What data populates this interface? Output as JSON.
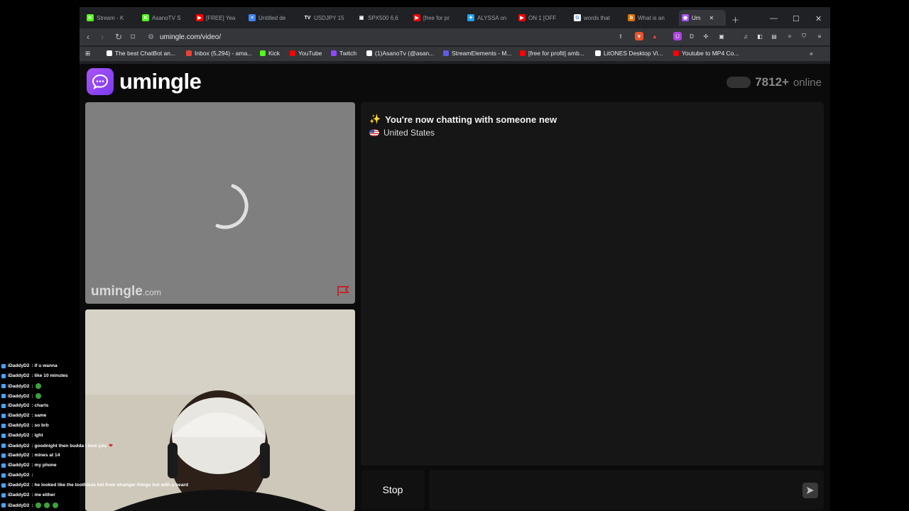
{
  "browser": {
    "tabs": [
      {
        "title": "Stream - K",
        "color": "#53fc18",
        "glyph": "K"
      },
      {
        "title": "AsanoTV S",
        "color": "#53fc18",
        "glyph": "K"
      },
      {
        "title": "[FREE] Yea",
        "color": "#ff0000",
        "glyph": "▶"
      },
      {
        "title": "Untitled de",
        "color": "#4285f4",
        "glyph": "≡"
      },
      {
        "title": "USDJPY 15",
        "color": "#202124",
        "glyph": "TV"
      },
      {
        "title": "SPX500 6,6",
        "color": "#202124",
        "glyph": "▣"
      },
      {
        "title": "[free for pr",
        "color": "#ff0000",
        "glyph": "▶"
      },
      {
        "title": "ALYSSA on",
        "color": "#1da1f2",
        "glyph": "✈"
      },
      {
        "title": "ON 1 [OFF",
        "color": "#ff0000",
        "glyph": "▶"
      },
      {
        "title": "words that",
        "color": "#ffffff",
        "glyph": "G"
      },
      {
        "title": "What is an",
        "color": "#d97706",
        "glyph": "b"
      },
      {
        "title": "Um",
        "color": "#a855f7",
        "glyph": "◉"
      }
    ],
    "url": "umingle.com/video/",
    "bookmarks": [
      {
        "label": "The best ChatBot an...",
        "color": "#ffffff"
      },
      {
        "label": "Inbox (5,294) - ama...",
        "color": "#ea4335"
      },
      {
        "label": "Kick",
        "color": "#53fc18"
      },
      {
        "label": "YouTube",
        "color": "#ff0000"
      },
      {
        "label": "Twitch",
        "color": "#9146ff"
      },
      {
        "label": "(1)AsanoTv (@asan...",
        "color": "#ffffff"
      },
      {
        "label": "StreamElements - M...",
        "color": "#5e5ce6"
      },
      {
        "label": "[free for profit] amb...",
        "color": "#ff0000"
      },
      {
        "label": "LitONES Desktop Vi...",
        "color": "#ffffff"
      },
      {
        "label": "Youtube to MP4 Co...",
        "color": "#ff0000"
      }
    ]
  },
  "site": {
    "logo": "umingle",
    "online_count": "7812+",
    "online_label": "online",
    "watermark_main": "umingle",
    "watermark_suffix": ".com",
    "chat_status": "You're now chatting with someone new",
    "country": "United States",
    "stop_label": "Stop",
    "accent_color": "#a855f7"
  },
  "overlay_chat": [
    {
      "user": "iDaddyD2",
      "msg": ": if u wanna"
    },
    {
      "user": "iDaddyD2",
      "msg": ": like 10 minutes"
    },
    {
      "user": "iDaddyD2",
      "msg": ":",
      "emotes": 1
    },
    {
      "user": "iDaddyD2",
      "msg": ":",
      "emotes": 1
    },
    {
      "user": "iDaddyD2",
      "msg": ": charts"
    },
    {
      "user": "iDaddyD2",
      "msg": ": same"
    },
    {
      "user": "iDaddyD2",
      "msg": ": so brb"
    },
    {
      "user": "iDaddyD2",
      "msg": ": ight"
    },
    {
      "user": "iDaddyD2",
      "msg": ": goodnight then budda I love you",
      "heart": "❤"
    },
    {
      "user": "iDaddyD2",
      "msg": ": mines at 14"
    },
    {
      "user": "iDaddyD2",
      "msg": ": my phone"
    },
    {
      "user": "iDaddyD2",
      "msg": ":"
    },
    {
      "user": "iDaddyD2",
      "msg": ": he looked like the toothless kid from stranger things but with a beard"
    },
    {
      "user": "iDaddyD2",
      "msg": ": me either"
    },
    {
      "user": "iDaddyD2",
      "msg": ":",
      "emotes": 3
    }
  ]
}
